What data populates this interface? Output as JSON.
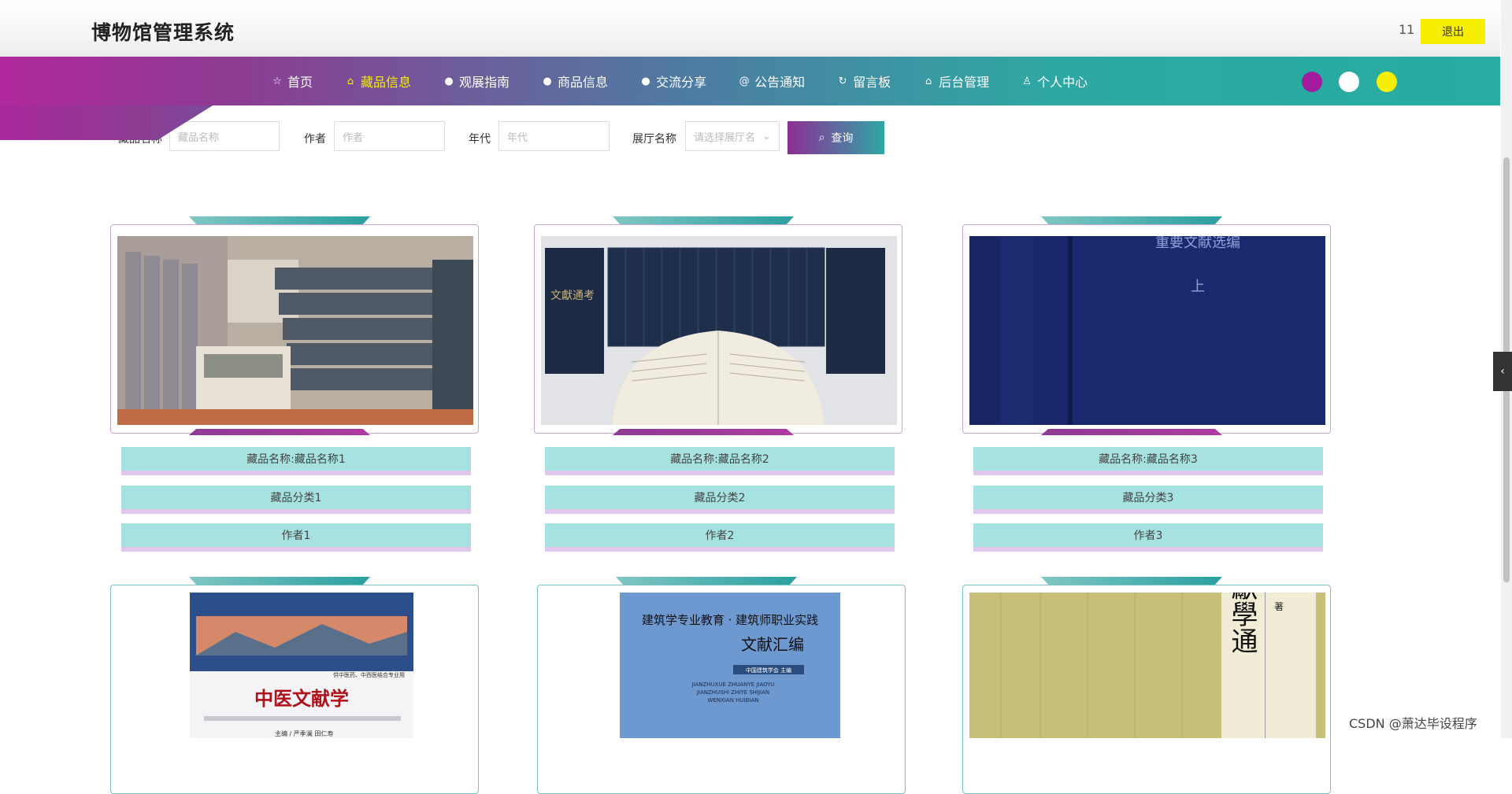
{
  "header": {
    "title": "博物馆管理系统",
    "user_count": "11",
    "logout_label": "退出"
  },
  "nav": {
    "items": [
      {
        "label": "首页",
        "icon": "star-icon"
      },
      {
        "label": "藏品信息",
        "icon": "bag-icon",
        "active": true
      },
      {
        "label": "观展指南",
        "icon": "info-icon"
      },
      {
        "label": "商品信息",
        "icon": "info-icon"
      },
      {
        "label": "交流分享",
        "icon": "info-icon"
      },
      {
        "label": "公告通知",
        "icon": "at-icon"
      },
      {
        "label": "留言板",
        "icon": "refresh-icon"
      },
      {
        "label": "后台管理",
        "icon": "bag-icon"
      },
      {
        "label": "个人中心",
        "icon": "user-icon"
      }
    ],
    "theme_colors": [
      "#a21c9e",
      "#ffffff",
      "#f7ef00"
    ]
  },
  "search": {
    "name_label": "藏品名称",
    "name_placeholder": "藏品名称",
    "author_label": "作者",
    "author_placeholder": "作者",
    "era_label": "年代",
    "era_placeholder": "年代",
    "hall_label": "展厅名称",
    "hall_placeholder": "请选择展厅名",
    "query_label": "查询"
  },
  "cards": [
    {
      "name": "藏品名称:藏品名称1",
      "category": "藏品分类1",
      "author": "作者1"
    },
    {
      "name": "藏品名称:藏品名称2",
      "category": "藏品分类2",
      "author": "作者2"
    },
    {
      "name": "藏品名称:藏品名称3",
      "category": "藏品分类3",
      "author": "作者3"
    },
    {
      "name": "",
      "category": "",
      "author": ""
    },
    {
      "name": "",
      "category": "",
      "author": ""
    },
    {
      "name": "",
      "category": "",
      "author": ""
    }
  ],
  "images": {
    "img2_title": "文獻通考",
    "img3_title": "重要文献选编",
    "img3_char": "上",
    "img4_title": "中医文献学",
    "img4_subtitle": "供中医药、中西医结合专业用",
    "img4_editor": "主编 / 严季澜  田仁寿",
    "img5_line1": "建筑学专业教育 · 建筑师职业实践",
    "img5_title": "文献汇编",
    "img5_org": "中国建筑学会 主编",
    "img5_pinyin": "JIANZHUXUE ZHUANYE JIAOYU JIANZHUSHI ZHIYE SHIJIAN WENXIAN HUIBIAN",
    "img6_title": "刻文獻學通",
    "img6_author_mark": "著"
  },
  "watermark": "CSDN @萧达毕设程序"
}
